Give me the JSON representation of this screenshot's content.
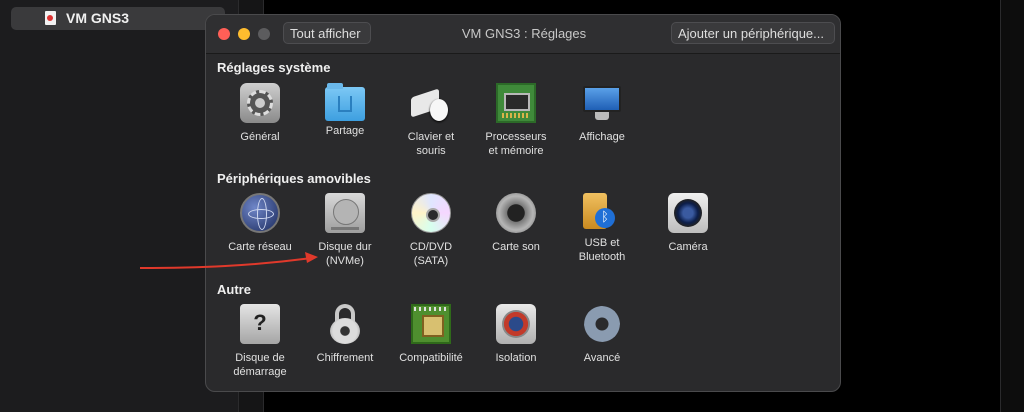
{
  "sidebar": {
    "vm_name": "VM GNS3"
  },
  "window": {
    "title": "VM GNS3 : Réglages",
    "show_all_label": "Tout afficher",
    "add_device_label": "Ajouter un périphérique..."
  },
  "sections": {
    "system": {
      "title": "Réglages système",
      "items": [
        {
          "label": "Général",
          "icon": "gear-icon"
        },
        {
          "label": "Partage",
          "icon": "shared-folder-icon"
        },
        {
          "label": "Clavier et\nsouris",
          "icon": "keyboard-mouse-icon"
        },
        {
          "label": "Processeurs\net mémoire",
          "icon": "memory-board-icon"
        },
        {
          "label": "Affichage",
          "icon": "monitor-icon"
        }
      ]
    },
    "removable": {
      "title": "Périphériques amovibles",
      "items": [
        {
          "label": "Carte réseau",
          "icon": "network-globe-icon"
        },
        {
          "label": "Disque dur\n(NVMe)",
          "icon": "hard-disk-icon"
        },
        {
          "label": "CD/DVD\n(SATA)",
          "icon": "cd-dvd-icon"
        },
        {
          "label": "Carte son",
          "icon": "speaker-icon"
        },
        {
          "label": "USB et\nBluetooth",
          "icon": "usb-bluetooth-icon"
        },
        {
          "label": "Caméra",
          "icon": "camera-icon"
        }
      ]
    },
    "other": {
      "title": "Autre",
      "items": [
        {
          "label": "Disque de\ndémarrage",
          "icon": "startup-disk-icon"
        },
        {
          "label": "Chiffrement",
          "icon": "lock-icon"
        },
        {
          "label": "Compatibilité",
          "icon": "chip-icon"
        },
        {
          "label": "Isolation",
          "icon": "isolation-icon"
        },
        {
          "label": "Avancé",
          "icon": "advanced-gear-icon"
        }
      ]
    }
  },
  "colors": {
    "window_bg": "#2a2a2c",
    "close": "#ff5f57",
    "minimize": "#febc2e",
    "annotation_arrow": "#e0392b"
  }
}
